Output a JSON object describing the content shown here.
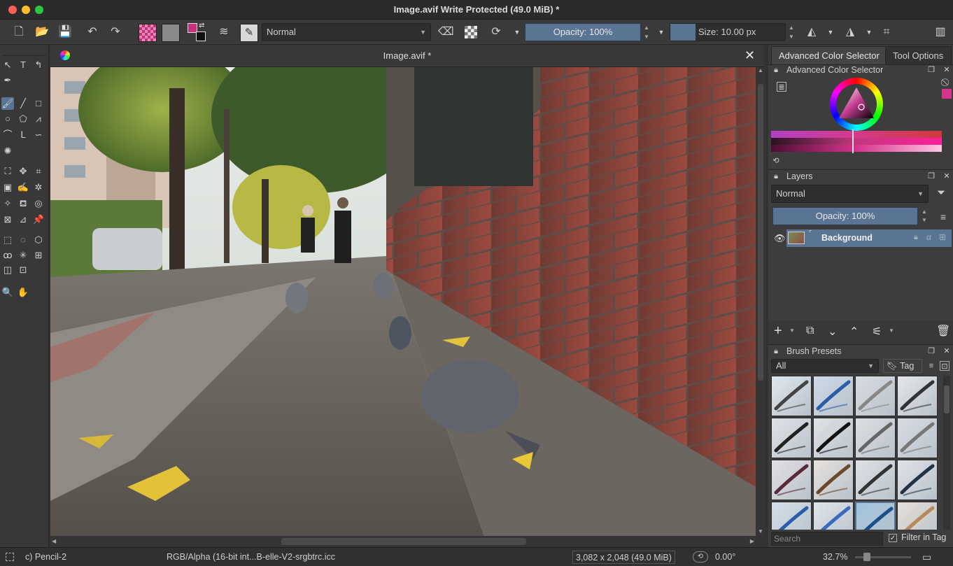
{
  "window": {
    "title": "Image.avif Write Protected  (49.0 MiB)  *"
  },
  "toolbar": {
    "blend_mode": "Normal",
    "opacity": "Opacity: 100%",
    "size": "Size: 10.00 px",
    "colors": {
      "fg": "#c8317a",
      "bg": "#111111",
      "accent": "#5a7594"
    }
  },
  "document": {
    "tab_title": "Image.avif *"
  },
  "dock": {
    "tabs": [
      "Advanced Color Selector",
      "Tool Options"
    ],
    "color_selector": {
      "title": "Advanced Color Selector",
      "current_color": "#d6338a"
    },
    "layers": {
      "title": "Layers",
      "blend_mode": "Normal",
      "opacity": "Opacity:  100%",
      "items": [
        {
          "name": "Background"
        }
      ]
    },
    "brush_presets": {
      "title": "Brush Presets",
      "filter": "All",
      "tag_label": "Tag",
      "search_placeholder": "Search",
      "filter_in_tag": "Filter in Tag"
    }
  },
  "statusbar": {
    "brush": "c) Pencil-2",
    "color_profile": "RGB/Alpha (16-bit int...B-elle-V2-srgbtrc.icc",
    "dimensions": "3,082 x 2,048 (49.0 MiB)",
    "rotation": "0.00°",
    "zoom": "32.7%"
  }
}
